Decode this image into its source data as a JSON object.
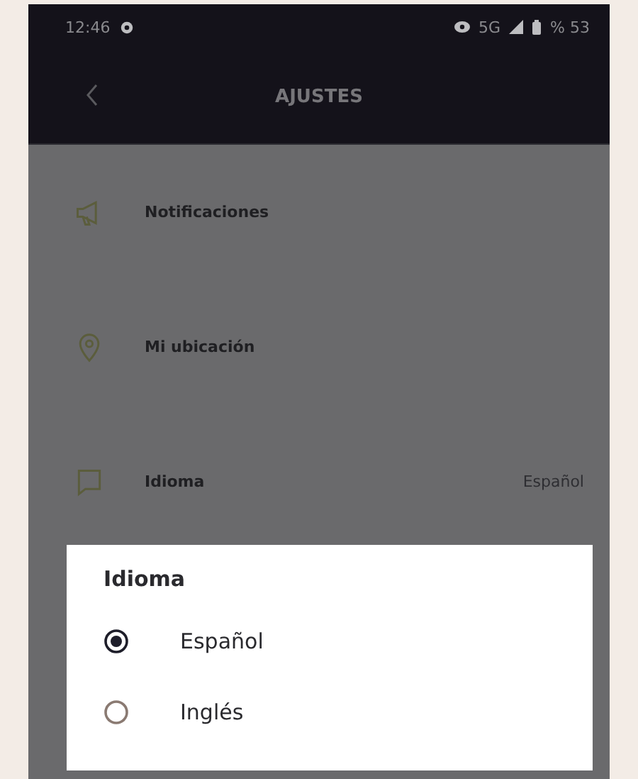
{
  "status_bar": {
    "time": "12:46",
    "network": "5G",
    "battery": "% 53"
  },
  "header": {
    "title": "AJUSTES"
  },
  "settings": [
    {
      "kind": "notifications",
      "label": "Notificaciones"
    },
    {
      "kind": "location",
      "label": "Mi ubicación"
    },
    {
      "kind": "language",
      "label": "Idioma",
      "value": "Español"
    }
  ],
  "dialog": {
    "title": "Idioma",
    "options": [
      {
        "label": "Español",
        "selected": true
      },
      {
        "label": "Inglés",
        "selected": false
      }
    ]
  }
}
